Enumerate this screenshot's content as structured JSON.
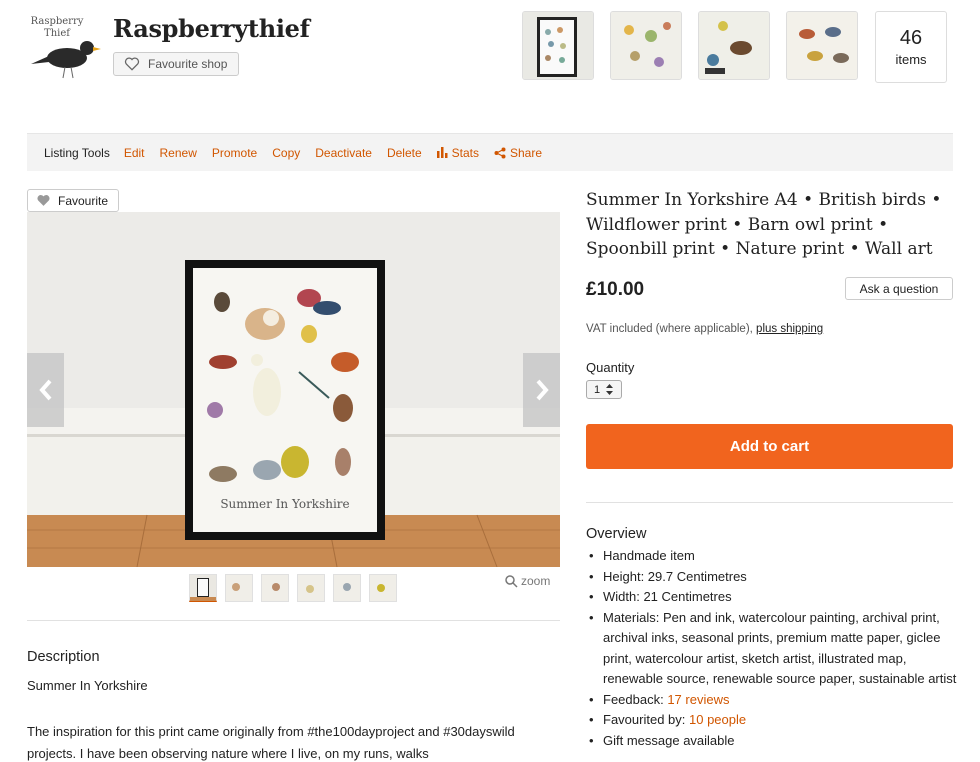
{
  "shop": {
    "logo_text_line1": "Raspberry",
    "logo_text_line2": "Thief",
    "name": "Raspberrythief",
    "favourite_shop_label": "Favourite shop",
    "items_count": "46",
    "items_label": "items"
  },
  "listing_tools": {
    "label": "Listing Tools",
    "edit": "Edit",
    "renew": "Renew",
    "promote": "Promote",
    "copy": "Copy",
    "deactivate": "Deactivate",
    "delete": "Delete",
    "stats": "Stats",
    "share": "Share"
  },
  "image": {
    "favourite_label": "Favourite",
    "print_caption": "Summer In Yorkshire",
    "zoom_label": "zoom",
    "gallery_count": 6,
    "active_index": 0
  },
  "description": {
    "heading": "Description",
    "subtitle": "Summer In Yorkshire",
    "body": "The inspiration for this print came originally from #the100dayproject and #30dayswild projects. I have been observing nature where I live, on my runs, walks"
  },
  "product": {
    "title": "Summer In Yorkshire A4 • British birds • Wildflower print • Barn owl print • Spoonbill print • Nature print • Wall art",
    "price": "£10.00",
    "ask_question": "Ask a question",
    "vat_text": "VAT included (where applicable),",
    "shipping_link": "plus shipping",
    "quantity_label": "Quantity",
    "quantity_value": "1",
    "add_to_cart": "Add to cart"
  },
  "overview": {
    "heading": "Overview",
    "handmade": "Handmade item",
    "height": "Height: 29.7 Centimetres",
    "width": "Width: 21 Centimetres",
    "materials": "Materials: Pen and ink, watercolour painting, archival print, archival inks, seasonal prints, premium matte paper, giclee print, watercolour artist, sketch artist, illustrated map, renewable source, renewable source paper, sustainable artist",
    "feedback_label": "Feedback:",
    "feedback_link": "17 reviews",
    "favourited_label": "Favourited by:",
    "favourited_link": "10 people",
    "gift_message": "Gift message available"
  },
  "colors": {
    "accent_orange": "#f1641e",
    "link_orange": "#d15600"
  }
}
